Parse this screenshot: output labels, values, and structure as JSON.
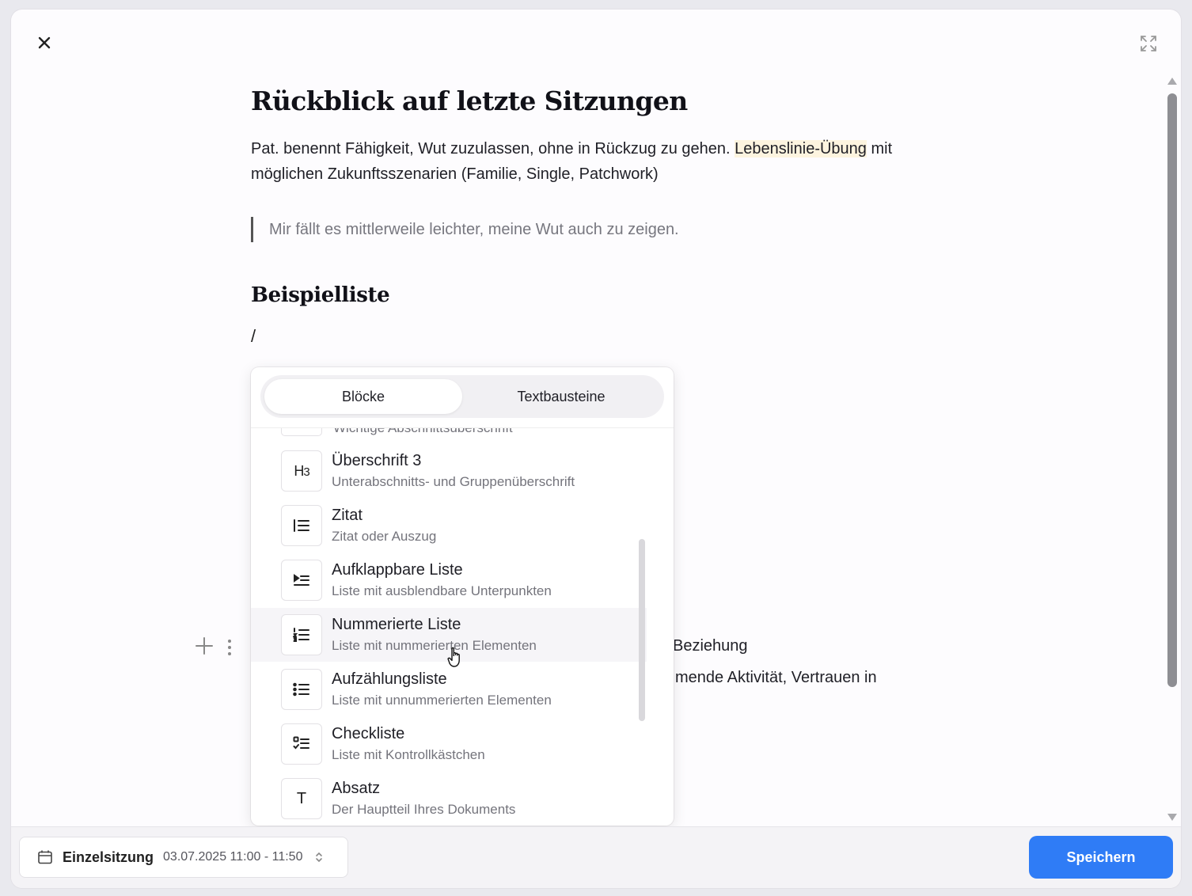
{
  "document": {
    "title": "Rückblick auf letzte Sitzungen",
    "paragraph_part1": "Pat. benennt Fähigkeit, Wut zuzulassen, ohne in Rückzug zu gehen. ",
    "paragraph_highlight": "Lebenslinie-Übung",
    "paragraph_part2": " mit möglichen Zukunftsszenarien (Familie, Single, Patchwork)",
    "quote": "Mir fällt es mittlerweile leichter, meine Wut auch zu zeigen.",
    "subtitle": "Beispielliste",
    "slash": "/",
    "hidden_line_1": "Beziehung",
    "hidden_line_2": "mende Aktivität, Vertrauen in"
  },
  "slash_menu": {
    "tabs": [
      {
        "label": "Blöcke",
        "active": true
      },
      {
        "label": "Textbausteine",
        "active": false
      }
    ],
    "partial_item_desc": "Wichtige Abschnittsüberschrift",
    "items": [
      {
        "icon": "heading-3-icon",
        "icon_text": "H3",
        "title": "Überschrift 3",
        "desc": "Unterabschnitts- und Gruppenüberschrift"
      },
      {
        "icon": "quote-icon",
        "title": "Zitat",
        "desc": "Zitat oder Auszug"
      },
      {
        "icon": "toggle-list-icon",
        "title": "Aufklappbare Liste",
        "desc": "Liste mit ausblendbare Unterpunkten"
      },
      {
        "icon": "numbered-list-icon",
        "title": "Nummerierte Liste",
        "desc": "Liste mit nummerierten Elementen"
      },
      {
        "icon": "bullet-list-icon",
        "title": "Aufzählungsliste",
        "desc": "Liste mit unnummerierten Elementen"
      },
      {
        "icon": "checklist-icon",
        "title": "Checkliste",
        "desc": "Liste mit Kontrollkästchen"
      },
      {
        "icon": "paragraph-icon",
        "icon_text": "T",
        "title": "Absatz",
        "desc": "Der Hauptteil Ihres Dokuments"
      }
    ]
  },
  "footer": {
    "session_type": "Einzelsitzung",
    "session_datetime": "03.07.2025 11:00 - 11:50",
    "save_label": "Speichern"
  },
  "colors": {
    "accent": "#2f7cf6",
    "highlight": "#fdf4df"
  }
}
